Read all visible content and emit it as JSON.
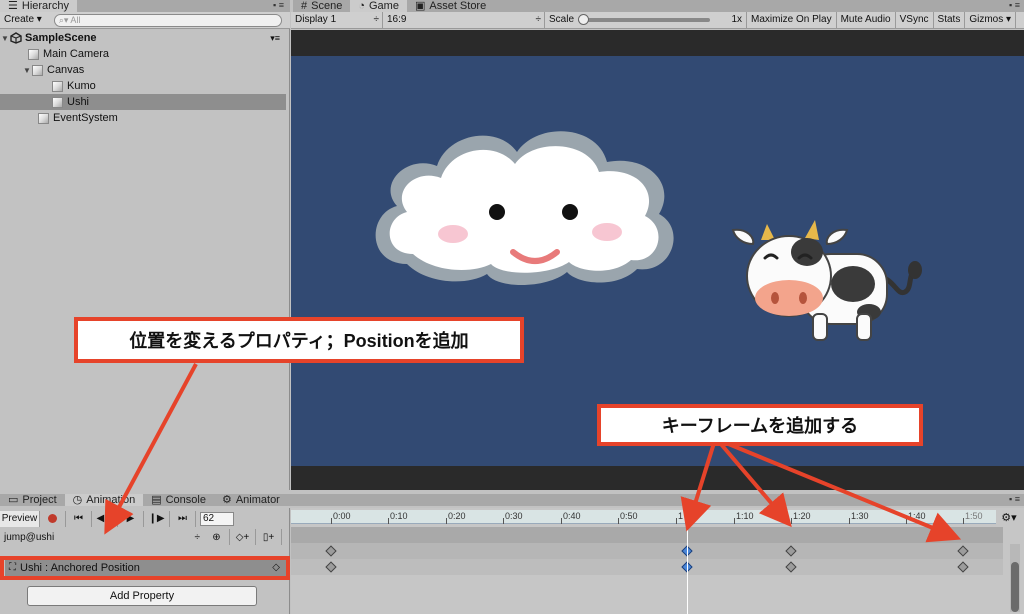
{
  "hierarchy": {
    "tab_label": "Hierarchy",
    "create_label": "Create",
    "search_placeholder": "All",
    "scene_name": "SampleScene",
    "items": [
      {
        "label": "Main Camera"
      },
      {
        "label": "Canvas"
      },
      {
        "label": "Kumo"
      },
      {
        "label": "Ushi"
      },
      {
        "label": "EventSystem"
      }
    ]
  },
  "game": {
    "tabs": [
      {
        "label": "Scene"
      },
      {
        "label": "Game"
      },
      {
        "label": "Asset Store"
      }
    ],
    "display": "Display 1",
    "aspect": "16:9",
    "scale_label": "Scale",
    "scale_value": "1x",
    "buttons": [
      "Maximize On Play",
      "Mute Audio",
      "VSync",
      "Stats",
      "Gizmos"
    ]
  },
  "animation": {
    "tabs": [
      {
        "label": "Project"
      },
      {
        "label": "Animation"
      },
      {
        "label": "Console"
      },
      {
        "label": "Animator"
      }
    ],
    "preview_label": "Preview",
    "frame": "62",
    "clip_name": "jump@ushi",
    "property_label": "Ushi : Anchored Position",
    "add_property_label": "Add Property",
    "ruler_ticks": [
      "0:00",
      "0:10",
      "0:20",
      "0:30",
      "0:40",
      "0:50",
      "1",
      "1:10",
      "1:20",
      "1:30",
      "1:40",
      "1:50"
    ]
  },
  "annotations": {
    "position_callout": "位置を変えるプロパティ；Positionを追加",
    "keyframe_callout": "キーフレームを追加する",
    "accent_color": "#e6432a"
  }
}
